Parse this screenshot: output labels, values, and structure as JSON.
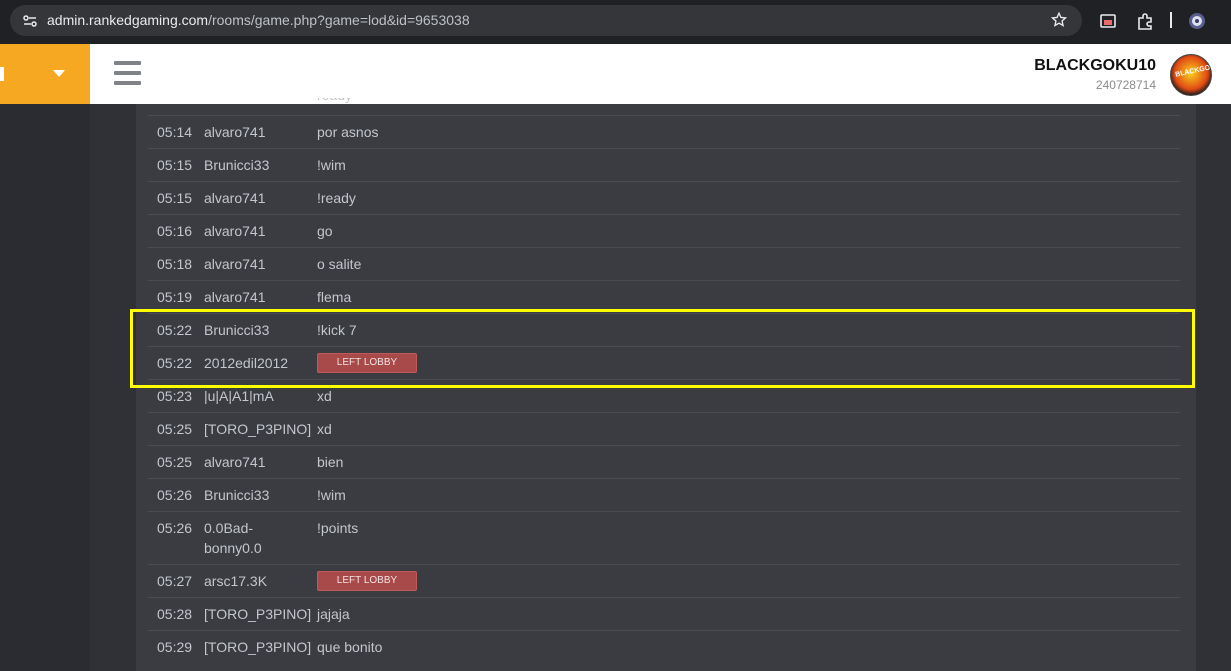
{
  "browser": {
    "url_host": "admin.rankedgaming.com",
    "url_path": "/rooms/game.php?game=lod&id=9653038"
  },
  "header": {
    "username": "BLACKGOKU10",
    "user_id": "240728714",
    "avatar_label": "BLACKGOKU"
  },
  "log": {
    "partial_top_msg": "ready",
    "rows": [
      {
        "time": "05:14",
        "user": "alvaro741",
        "msg": "por asnos"
      },
      {
        "time": "05:15",
        "user": "Brunicci33",
        "msg": "!wim"
      },
      {
        "time": "05:15",
        "user": "alvaro741",
        "msg": "!ready"
      },
      {
        "time": "05:16",
        "user": "alvaro741",
        "msg": "go"
      },
      {
        "time": "05:18",
        "user": "alvaro741",
        "msg": "o salite"
      },
      {
        "time": "05:19",
        "user": "alvaro741",
        "msg": "flema"
      },
      {
        "time": "05:22",
        "user": "Brunicci33",
        "msg": "!kick 7"
      },
      {
        "time": "05:22",
        "user": "2012edil2012",
        "badge": "LEFT LOBBY"
      },
      {
        "time": "05:23",
        "user": "|u|A|A1|mA",
        "msg": "xd"
      },
      {
        "time": "05:25",
        "user": "[TORO_P3PINO]",
        "msg": "xd"
      },
      {
        "time": "05:25",
        "user": "alvaro741",
        "msg": "bien"
      },
      {
        "time": "05:26",
        "user": "Brunicci33",
        "msg": "!wim"
      },
      {
        "time": "05:26",
        "user": "0.0Bad-bonny0.0",
        "msg": "!points"
      },
      {
        "time": "05:27",
        "user": "arsc17.3K",
        "badge": "LEFT LOBBY"
      },
      {
        "time": "05:28",
        "user": "[TORO_P3PINO]",
        "msg": "jajaja"
      },
      {
        "time": "05:29",
        "user": "[TORO_P3PINO]",
        "msg": "que bonito"
      }
    ]
  },
  "colors": {
    "highlight": "#ffff00",
    "accent": "#f6a823",
    "badge": "#a8494a"
  }
}
